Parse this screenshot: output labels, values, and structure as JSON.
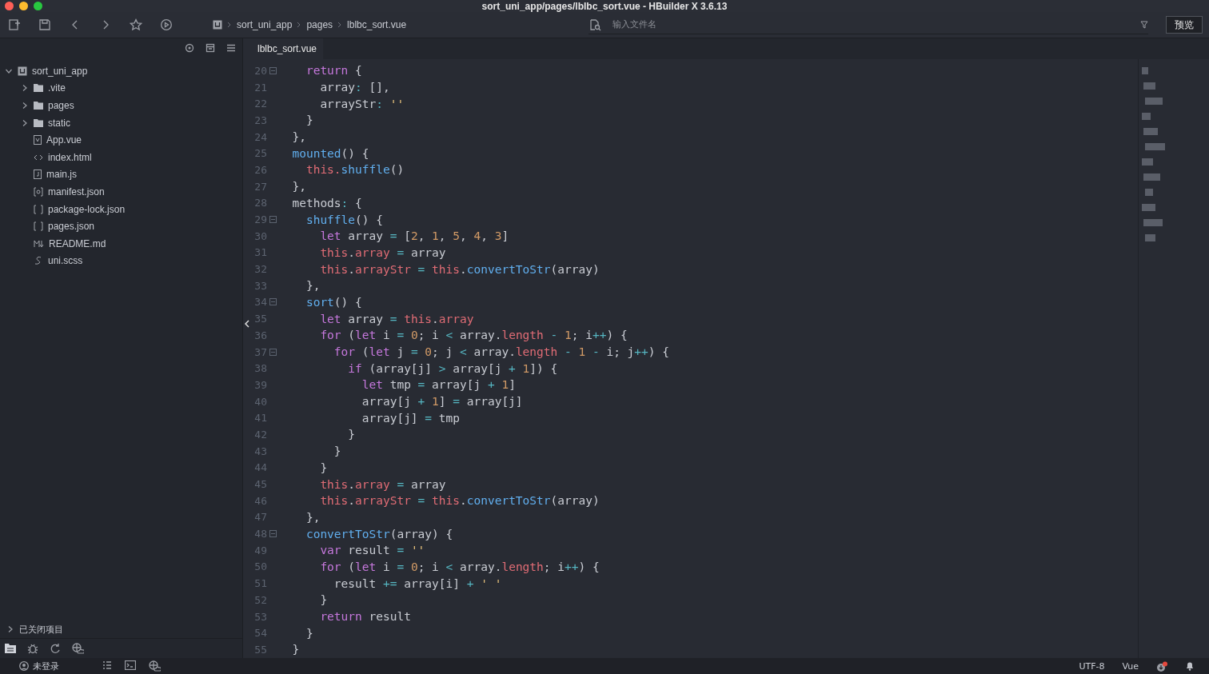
{
  "window": {
    "title": "sort_uni_app/pages/lblbc_sort.vue - HBuilder X 3.6.13"
  },
  "toolbar": {
    "breadcrumbs": [
      "sort_uni_app",
      "pages",
      "lblbc_sort.vue"
    ],
    "search": {
      "placeholder": "输入文件名"
    },
    "preview_button": "预览"
  },
  "sidebar": {
    "tree": [
      {
        "label": "sort_uni_app",
        "kind": "project",
        "expanded": true,
        "children": [
          {
            "label": ".vite",
            "kind": "folder",
            "expanded": false
          },
          {
            "label": "pages",
            "kind": "folder",
            "expanded": false
          },
          {
            "label": "static",
            "kind": "folder",
            "expanded": false
          },
          {
            "label": "App.vue",
            "kind": "vue"
          },
          {
            "label": "index.html",
            "kind": "html"
          },
          {
            "label": "main.js",
            "kind": "js"
          },
          {
            "label": "manifest.json",
            "kind": "manifest"
          },
          {
            "label": "package-lock.json",
            "kind": "json"
          },
          {
            "label": "pages.json",
            "kind": "json"
          },
          {
            "label": "README.md",
            "kind": "markdown"
          },
          {
            "label": "uni.scss",
            "kind": "style"
          }
        ]
      }
    ],
    "closed_projects": {
      "label": "已关闭项目",
      "expanded": false
    }
  },
  "editor": {
    "tabs": [
      {
        "label": "lblbc_sort.vue",
        "selected": true
      }
    ],
    "lines": [
      {
        "number": "20",
        "foldable": true,
        "tokens": [
          {
            "kind": "keyword",
            "text": "    return"
          },
          {
            "kind": "plain",
            "text": " {"
          }
        ]
      },
      {
        "number": "21",
        "foldable": false,
        "tokens": [
          {
            "kind": "plain",
            "text": "      array"
          },
          {
            "kind": "operator",
            "text": ":"
          },
          {
            "kind": "plain",
            "text": " [],"
          }
        ]
      },
      {
        "number": "22",
        "foldable": false,
        "tokens": [
          {
            "kind": "plain",
            "text": "      arrayStr"
          },
          {
            "kind": "operator",
            "text": ":"
          },
          {
            "kind": "string",
            "text": " ''"
          }
        ]
      },
      {
        "number": "23",
        "foldable": false,
        "tokens": [
          {
            "kind": "plain",
            "text": "    }"
          }
        ]
      },
      {
        "number": "24",
        "foldable": false,
        "tokens": [
          {
            "kind": "plain",
            "text": "  },"
          }
        ]
      },
      {
        "number": "25",
        "foldable": false,
        "tokens": [
          {
            "kind": "function",
            "text": "  mounted"
          },
          {
            "kind": "plain",
            "text": "() {"
          }
        ]
      },
      {
        "number": "26",
        "foldable": false,
        "tokens": [
          {
            "kind": "this",
            "text": "    this."
          },
          {
            "kind": "function",
            "text": "shuffle"
          },
          {
            "kind": "plain",
            "text": "()"
          }
        ]
      },
      {
        "number": "27",
        "foldable": false,
        "tokens": [
          {
            "kind": "plain",
            "text": "  },"
          }
        ]
      },
      {
        "number": "28",
        "foldable": false,
        "tokens": [
          {
            "kind": "plain",
            "text": "  methods"
          },
          {
            "kind": "operator",
            "text": ":"
          },
          {
            "kind": "plain",
            "text": " {"
          }
        ]
      },
      {
        "number": "29",
        "foldable": true,
        "tokens": [
          {
            "kind": "function",
            "text": "    shuffle"
          },
          {
            "kind": "plain",
            "text": "() {"
          }
        ]
      },
      {
        "number": "30",
        "foldable": false,
        "tokens": [
          {
            "kind": "keyword",
            "text": "      let"
          },
          {
            "kind": "plain",
            "text": " array "
          },
          {
            "kind": "operator",
            "text": "="
          },
          {
            "kind": "plain",
            "text": " ["
          },
          {
            "kind": "number",
            "text": "2"
          },
          {
            "kind": "plain",
            "text": ", "
          },
          {
            "kind": "number",
            "text": "1"
          },
          {
            "kind": "plain",
            "text": ", "
          },
          {
            "kind": "number",
            "text": "5"
          },
          {
            "kind": "plain",
            "text": ", "
          },
          {
            "kind": "number",
            "text": "4"
          },
          {
            "kind": "plain",
            "text": ", "
          },
          {
            "kind": "number",
            "text": "3"
          },
          {
            "kind": "plain",
            "text": "]"
          }
        ]
      },
      {
        "number": "31",
        "foldable": false,
        "tokens": [
          {
            "kind": "this",
            "text": "      this"
          },
          {
            "kind": "plain",
            "text": "."
          },
          {
            "kind": "this",
            "text": "array"
          },
          {
            "kind": "operator",
            "text": " ="
          },
          {
            "kind": "plain",
            "text": " array"
          }
        ]
      },
      {
        "number": "32",
        "foldable": false,
        "tokens": [
          {
            "kind": "this",
            "text": "      this"
          },
          {
            "kind": "plain",
            "text": "."
          },
          {
            "kind": "this",
            "text": "arrayStr"
          },
          {
            "kind": "operator",
            "text": " ="
          },
          {
            "kind": "this",
            "text": " this"
          },
          {
            "kind": "plain",
            "text": "."
          },
          {
            "kind": "function",
            "text": "convertToStr"
          },
          {
            "kind": "plain",
            "text": "(array)"
          }
        ]
      },
      {
        "number": "33",
        "foldable": false,
        "tokens": [
          {
            "kind": "plain",
            "text": "    },"
          }
        ]
      },
      {
        "number": "34",
        "foldable": true,
        "tokens": [
          {
            "kind": "function",
            "text": "    sort"
          },
          {
            "kind": "plain",
            "text": "() {"
          }
        ]
      },
      {
        "number": "35",
        "foldable": false,
        "tokens": [
          {
            "kind": "keyword",
            "text": "      let"
          },
          {
            "kind": "plain",
            "text": " array "
          },
          {
            "kind": "operator",
            "text": "="
          },
          {
            "kind": "this",
            "text": " this"
          },
          {
            "kind": "plain",
            "text": "."
          },
          {
            "kind": "this",
            "text": "array"
          }
        ]
      },
      {
        "number": "36",
        "foldable": false,
        "tokens": [
          {
            "kind": "keyword",
            "text": "      for"
          },
          {
            "kind": "plain",
            "text": " ("
          },
          {
            "kind": "keyword",
            "text": "let"
          },
          {
            "kind": "plain",
            "text": " i "
          },
          {
            "kind": "operator",
            "text": "="
          },
          {
            "kind": "number",
            "text": " 0"
          },
          {
            "kind": "plain",
            "text": "; i "
          },
          {
            "kind": "operator",
            "text": "<"
          },
          {
            "kind": "plain",
            "text": " array."
          },
          {
            "kind": "this",
            "text": "length"
          },
          {
            "kind": "operator",
            "text": " -"
          },
          {
            "kind": "number",
            "text": " 1"
          },
          {
            "kind": "plain",
            "text": "; i"
          },
          {
            "kind": "operator",
            "text": "++"
          },
          {
            "kind": "plain",
            "text": ") {"
          }
        ]
      },
      {
        "number": "37",
        "foldable": true,
        "tokens": [
          {
            "kind": "keyword",
            "text": "        for"
          },
          {
            "kind": "plain",
            "text": " ("
          },
          {
            "kind": "keyword",
            "text": "let"
          },
          {
            "kind": "plain",
            "text": " j "
          },
          {
            "kind": "operator",
            "text": "="
          },
          {
            "kind": "number",
            "text": " 0"
          },
          {
            "kind": "plain",
            "text": "; j "
          },
          {
            "kind": "operator",
            "text": "<"
          },
          {
            "kind": "plain",
            "text": " array."
          },
          {
            "kind": "this",
            "text": "length"
          },
          {
            "kind": "operator",
            "text": " -"
          },
          {
            "kind": "number",
            "text": " 1"
          },
          {
            "kind": "operator",
            "text": " -"
          },
          {
            "kind": "plain",
            "text": " i; j"
          },
          {
            "kind": "operator",
            "text": "++"
          },
          {
            "kind": "plain",
            "text": ") {"
          }
        ]
      },
      {
        "number": "38",
        "foldable": false,
        "tokens": [
          {
            "kind": "keyword",
            "text": "          if"
          },
          {
            "kind": "plain",
            "text": " (array[j] "
          },
          {
            "kind": "operator",
            "text": ">"
          },
          {
            "kind": "plain",
            "text": " array[j "
          },
          {
            "kind": "operator",
            "text": "+"
          },
          {
            "kind": "number",
            "text": " 1"
          },
          {
            "kind": "plain",
            "text": "]) {"
          }
        ]
      },
      {
        "number": "39",
        "foldable": false,
        "tokens": [
          {
            "kind": "keyword",
            "text": "            let"
          },
          {
            "kind": "plain",
            "text": " tmp "
          },
          {
            "kind": "operator",
            "text": "="
          },
          {
            "kind": "plain",
            "text": " array[j "
          },
          {
            "kind": "operator",
            "text": "+"
          },
          {
            "kind": "number",
            "text": " 1"
          },
          {
            "kind": "plain",
            "text": "]"
          }
        ]
      },
      {
        "number": "40",
        "foldable": false,
        "tokens": [
          {
            "kind": "plain",
            "text": "            array[j "
          },
          {
            "kind": "operator",
            "text": "+"
          },
          {
            "kind": "number",
            "text": " 1"
          },
          {
            "kind": "plain",
            "text": "] "
          },
          {
            "kind": "operator",
            "text": "="
          },
          {
            "kind": "plain",
            "text": " array[j]"
          }
        ]
      },
      {
        "number": "41",
        "foldable": false,
        "tokens": [
          {
            "kind": "plain",
            "text": "            array[j] "
          },
          {
            "kind": "operator",
            "text": "="
          },
          {
            "kind": "plain",
            "text": " tmp"
          }
        ]
      },
      {
        "number": "42",
        "foldable": false,
        "tokens": [
          {
            "kind": "plain",
            "text": "          }"
          }
        ]
      },
      {
        "number": "43",
        "foldable": false,
        "tokens": [
          {
            "kind": "plain",
            "text": "        }"
          }
        ]
      },
      {
        "number": "44",
        "foldable": false,
        "tokens": [
          {
            "kind": "plain",
            "text": "      }"
          }
        ]
      },
      {
        "number": "45",
        "foldable": false,
        "tokens": [
          {
            "kind": "this",
            "text": "      this"
          },
          {
            "kind": "plain",
            "text": "."
          },
          {
            "kind": "this",
            "text": "array"
          },
          {
            "kind": "operator",
            "text": " ="
          },
          {
            "kind": "plain",
            "text": " array"
          }
        ]
      },
      {
        "number": "46",
        "foldable": false,
        "tokens": [
          {
            "kind": "this",
            "text": "      this"
          },
          {
            "kind": "plain",
            "text": "."
          },
          {
            "kind": "this",
            "text": "arrayStr"
          },
          {
            "kind": "operator",
            "text": " ="
          },
          {
            "kind": "this",
            "text": " this"
          },
          {
            "kind": "plain",
            "text": "."
          },
          {
            "kind": "function",
            "text": "convertToStr"
          },
          {
            "kind": "plain",
            "text": "(array)"
          }
        ]
      },
      {
        "number": "47",
        "foldable": false,
        "tokens": [
          {
            "kind": "plain",
            "text": "    },"
          }
        ]
      },
      {
        "number": "48",
        "foldable": true,
        "tokens": [
          {
            "kind": "function",
            "text": "    convertToStr"
          },
          {
            "kind": "plain",
            "text": "(array) {"
          }
        ]
      },
      {
        "number": "49",
        "foldable": false,
        "tokens": [
          {
            "kind": "keyword",
            "text": "      var"
          },
          {
            "kind": "plain",
            "text": " result "
          },
          {
            "kind": "operator",
            "text": "="
          },
          {
            "kind": "string",
            "text": " ''"
          }
        ]
      },
      {
        "number": "50",
        "foldable": false,
        "tokens": [
          {
            "kind": "keyword",
            "text": "      for"
          },
          {
            "kind": "plain",
            "text": " ("
          },
          {
            "kind": "keyword",
            "text": "let"
          },
          {
            "kind": "plain",
            "text": " i "
          },
          {
            "kind": "operator",
            "text": "="
          },
          {
            "kind": "number",
            "text": " 0"
          },
          {
            "kind": "plain",
            "text": "; i "
          },
          {
            "kind": "operator",
            "text": "<"
          },
          {
            "kind": "plain",
            "text": " array."
          },
          {
            "kind": "this",
            "text": "length"
          },
          {
            "kind": "plain",
            "text": "; i"
          },
          {
            "kind": "operator",
            "text": "++"
          },
          {
            "kind": "plain",
            "text": ") {"
          }
        ]
      },
      {
        "number": "51",
        "foldable": false,
        "tokens": [
          {
            "kind": "plain",
            "text": "        result "
          },
          {
            "kind": "operator",
            "text": "+="
          },
          {
            "kind": "plain",
            "text": " array[i] "
          },
          {
            "kind": "operator",
            "text": "+"
          },
          {
            "kind": "string",
            "text": " ' '"
          }
        ]
      },
      {
        "number": "52",
        "foldable": false,
        "tokens": [
          {
            "kind": "plain",
            "text": "      }"
          }
        ]
      },
      {
        "number": "53",
        "foldable": false,
        "tokens": [
          {
            "kind": "keyword",
            "text": "      return"
          },
          {
            "kind": "plain",
            "text": " result"
          }
        ]
      },
      {
        "number": "54",
        "foldable": false,
        "tokens": [
          {
            "kind": "plain",
            "text": "    }"
          }
        ]
      },
      {
        "number": "55",
        "foldable": false,
        "tokens": [
          {
            "kind": "plain",
            "text": "  }"
          }
        ]
      }
    ]
  },
  "status_bar": {
    "user": "未登录",
    "encoding": "UTF-8",
    "language": "Vue",
    "update_badge": true
  }
}
